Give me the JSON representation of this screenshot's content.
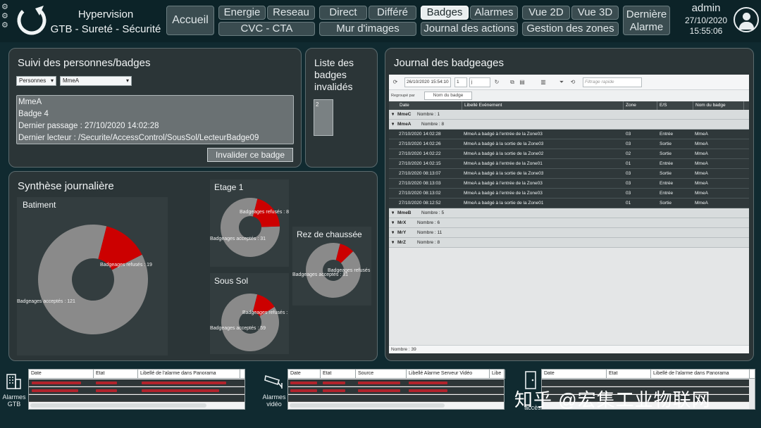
{
  "app": {
    "title_line1": "Hypervision",
    "title_line2": "GTB - Sureté - Sécurité"
  },
  "nav": {
    "home": "Accueil",
    "energy": "Energie",
    "network": "Reseau",
    "direct": "Direct",
    "deferred": "Différé",
    "badges": "Badges",
    "alarms": "Alarmes",
    "view2d": "Vue 2D",
    "view3d": "Vue 3D",
    "last_alarm_1": "Dernière",
    "last_alarm_2": "Alarme",
    "hvac": "CVC - CTA",
    "image_wall": "Mur d'images",
    "action_log": "Journal des actions",
    "zone_mgmt": "Gestion des zones"
  },
  "user": {
    "name": "admin",
    "date": "27/10/2020",
    "time": "15:55:06"
  },
  "tracking": {
    "title": "Suivi des personnes/badges",
    "type_select": "Personnes",
    "person_select": "MmeA",
    "info_line1": "MmeA",
    "info_line2": "Badge 4",
    "info_line3": "Dernier passage : 27/10/2020 14:02:28",
    "info_line4": "Dernier lecteur : /Securite/AccessControl/SousSol/LecteurBadge09",
    "invalidate_button": "Invalider ce badge"
  },
  "invalid": {
    "title_line1": "Liste des",
    "title_line2": "badges",
    "title_line3": "invalidés",
    "items": [
      "2"
    ]
  },
  "synthesis": {
    "title": "Synthèse journalière",
    "colors": {
      "accepted": "#8a8a8a",
      "refused": "#cc0000"
    }
  },
  "chart_data": [
    {
      "type": "pie",
      "title": "Batiment",
      "categories": [
        "Badgeages acceptés",
        "Badgeages refusés"
      ],
      "values": [
        121,
        19
      ],
      "labels": [
        "Badgeages acceptés : 121",
        "Badgeages refusés : 19"
      ]
    },
    {
      "type": "pie",
      "title": "Etage 1",
      "categories": [
        "Badgeages acceptés",
        "Badgeages refusés"
      ],
      "values": [
        31,
        8
      ],
      "labels": [
        "Badgeages acceptés : 31",
        "Badgeages refusés : 8"
      ]
    },
    {
      "type": "pie",
      "title": "Sous Sol",
      "categories": [
        "Badgeages acceptés",
        "Badgeages refusés"
      ],
      "values": [
        59,
        8
      ],
      "labels": [
        "Badgeages acceptés : 59",
        "Badgeages refusés :"
      ]
    },
    {
      "type": "pie",
      "title": "Rez de chaussée",
      "categories": [
        "Badgeages acceptés",
        "Badgeages refusés"
      ],
      "values": [
        31,
        3
      ],
      "labels": [
        "Badgeages acceptés : 31",
        "Badgeages refusés"
      ]
    }
  ],
  "journal": {
    "title": "Journal des badgeages",
    "toolbar": {
      "date": "26/10/2020 15:54:10",
      "count": "1",
      "unit": "j",
      "filter_placeholder": "Filtrage rapide"
    },
    "group_by_label": "Regroupé par",
    "group_chip": "Nom du badge",
    "columns": [
      "Date",
      "Libellé Evénement",
      "Zone",
      "E/S",
      "Nom du badge"
    ],
    "groups_top": [
      {
        "label": "MmeC",
        "count": "Nombre : 1"
      },
      {
        "label": "MmeA",
        "count": "Nombre : 8"
      }
    ],
    "rows": [
      [
        "27/10/2020 14:02:28",
        "MmeA a badgé à l'entrée de la Zone03",
        "03",
        "Entrée",
        "MmeA"
      ],
      [
        "27/10/2020 14:02:26",
        "MmeA a badgé à la sortie de la Zone03",
        "03",
        "Sortie",
        "MmeA"
      ],
      [
        "27/10/2020 14:02:22",
        "MmeA a badgé à la sortie de la Zone02",
        "02",
        "Sortie",
        "MmeA"
      ],
      [
        "27/10/2020 14:02:15",
        "MmeA a badgé à l'entrée de la Zone01",
        "01",
        "Entrée",
        "MmeA"
      ],
      [
        "27/10/2020 08:13:07",
        "MmeA a badgé à la sortie de la Zone03",
        "03",
        "Sortie",
        "MmeA"
      ],
      [
        "27/10/2020 08:13:03",
        "MmeA a badgé à l'entrée de la Zone03",
        "03",
        "Entrée",
        "MmeA"
      ],
      [
        "27/10/2020 08:13:02",
        "MmeA a badgé à l'entrée de la Zone03",
        "03",
        "Entrée",
        "MmeA"
      ],
      [
        "27/10/2020 08:12:52",
        "MmeA a badgé à la sortie de la Zone01",
        "01",
        "Sortie",
        "MmeA"
      ]
    ],
    "groups_bottom": [
      {
        "label": "MmeB",
        "count": "Nombre : 5"
      },
      {
        "label": "MrX",
        "count": "Nombre : 6"
      },
      {
        "label": "MrY",
        "count": "Nombre : 11"
      },
      {
        "label": "MrZ",
        "count": "Nombre : 8"
      }
    ],
    "footer": "Nombre : 39"
  },
  "alarms": {
    "gtb": {
      "label_line1": "Alarmes",
      "label_line2": "GTB",
      "columns": [
        "Date",
        "Etat",
        "Libellé de l'alarme dans Panorama"
      ]
    },
    "video": {
      "label_line1": "Alarmes",
      "label_line2": "vidéo",
      "columns": [
        "Date",
        "Etat",
        "Source",
        "Libellé Alarme Serveur Vidéo",
        "Libe"
      ]
    },
    "access": {
      "label_line1": "accès",
      "columns": [
        "Date",
        "Etat",
        "Libellé de l'alarme dans Panorama"
      ]
    }
  },
  "watermark": "知乎 @宏集工业物联网"
}
